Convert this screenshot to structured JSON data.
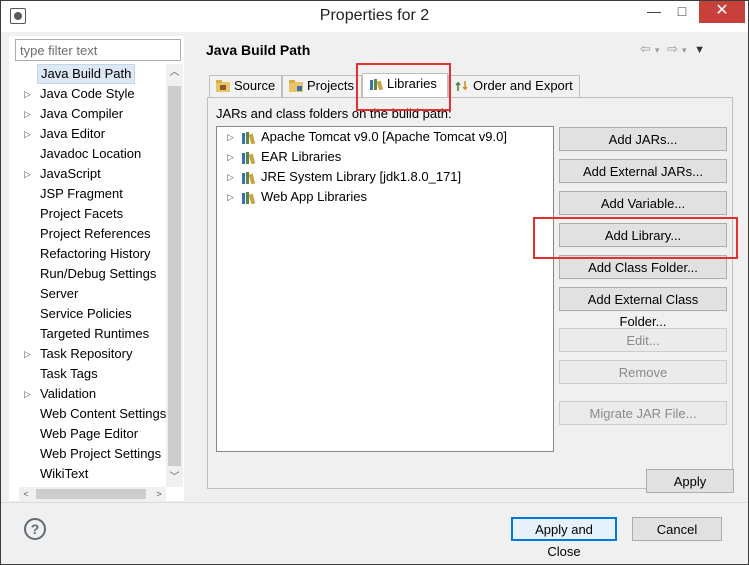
{
  "window": {
    "title": "Properties for 2",
    "minimize": "—",
    "maximize": "□",
    "close": "✕"
  },
  "filter": {
    "placeholder": "type filter text"
  },
  "sidebar": {
    "items": [
      {
        "label": "Java Build Path",
        "expandable": false,
        "selected": true
      },
      {
        "label": "Java Code Style",
        "expandable": true
      },
      {
        "label": "Java Compiler",
        "expandable": true
      },
      {
        "label": "Java Editor",
        "expandable": true
      },
      {
        "label": "Javadoc Location",
        "expandable": false
      },
      {
        "label": "JavaScript",
        "expandable": true
      },
      {
        "label": "JSP Fragment",
        "expandable": false
      },
      {
        "label": "Project Facets",
        "expandable": false
      },
      {
        "label": "Project References",
        "expandable": false
      },
      {
        "label": "Refactoring History",
        "expandable": false
      },
      {
        "label": "Run/Debug Settings",
        "expandable": false
      },
      {
        "label": "Server",
        "expandable": false
      },
      {
        "label": "Service Policies",
        "expandable": false
      },
      {
        "label": "Targeted Runtimes",
        "expandable": false
      },
      {
        "label": "Task Repository",
        "expandable": true
      },
      {
        "label": "Task Tags",
        "expandable": false
      },
      {
        "label": "Validation",
        "expandable": true
      },
      {
        "label": "Web Content Settings",
        "expandable": false
      },
      {
        "label": "Web Page Editor",
        "expandable": false
      },
      {
        "label": "Web Project Settings",
        "expandable": false
      },
      {
        "label": "WikiText",
        "expandable": false
      }
    ]
  },
  "page": {
    "title": "Java Build Path",
    "tabs": [
      {
        "label": "Source",
        "active": false
      },
      {
        "label": "Projects",
        "active": false
      },
      {
        "label": "Libraries",
        "active": true
      },
      {
        "label": "Order and Export",
        "active": false
      }
    ],
    "hint": "JARs and class folders on the build path:",
    "libraries": [
      "Apache Tomcat v9.0 [Apache Tomcat v9.0]",
      "EAR Libraries",
      "JRE System Library [jdk1.8.0_171]",
      "Web App Libraries"
    ],
    "buttons": {
      "add_jars": "Add JARs...",
      "add_external_jars": "Add External JARs...",
      "add_variable": "Add Variable...",
      "add_library": "Add Library...",
      "add_class_folder": "Add Class Folder...",
      "add_external_class_folder": "Add External Class Folder...",
      "edit": "Edit...",
      "remove": "Remove",
      "migrate_jar": "Migrate JAR File..."
    },
    "apply": "Apply"
  },
  "footer": {
    "help": "?",
    "apply_and_close": "Apply and Close",
    "cancel": "Cancel"
  },
  "colors": {
    "highlight": "#e33131",
    "selection": "#dde8f5",
    "close_button": "#c7403a"
  }
}
